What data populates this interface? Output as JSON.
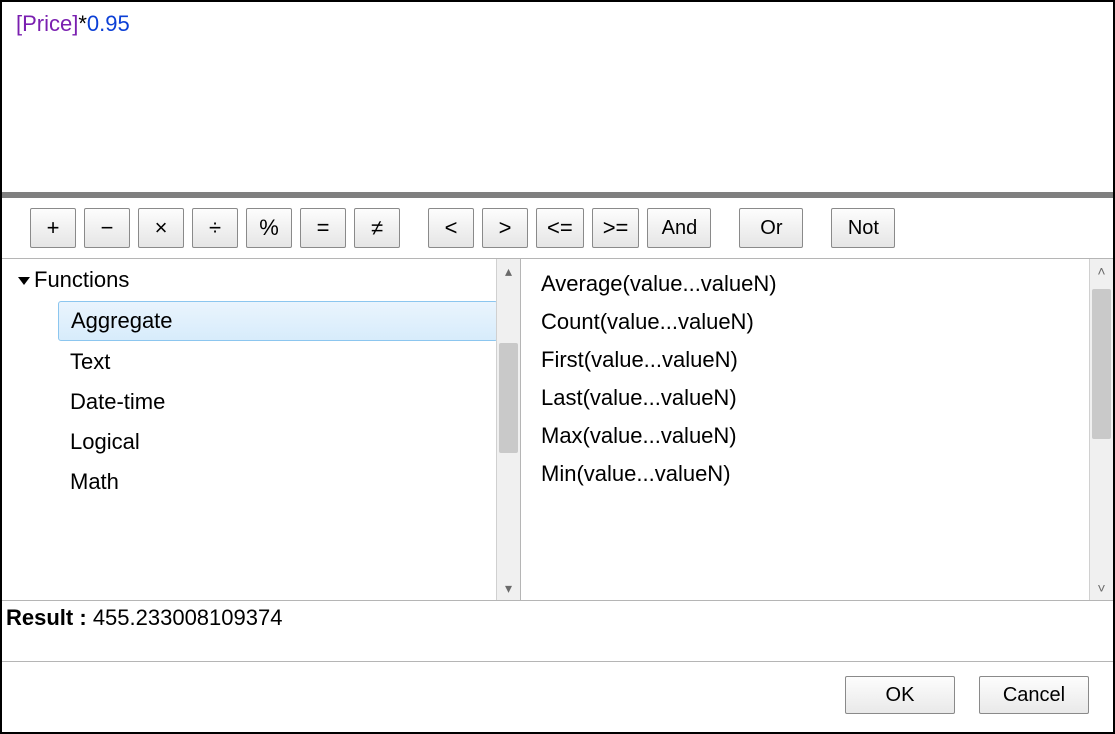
{
  "expression": {
    "field": "[Price]",
    "operator": "*",
    "number": "0.95"
  },
  "toolbar": {
    "ops": [
      "+",
      "−",
      "×",
      "÷",
      "%",
      "=",
      "≠",
      "<",
      ">",
      "<=",
      ">="
    ],
    "logic": [
      "And",
      "Or",
      "Not"
    ]
  },
  "tree": {
    "root_label": "Functions",
    "items": [
      "Aggregate",
      "Text",
      "Date-time",
      "Logical",
      "Math"
    ],
    "selected_index": 0
  },
  "functions": [
    "Average(value...valueN)",
    "Count(value...valueN)",
    "First(value...valueN)",
    "Last(value...valueN)",
    "Max(value...valueN)",
    "Min(value...valueN)"
  ],
  "result": {
    "label": "Result :",
    "value": "455.233008109374"
  },
  "footer": {
    "ok": "OK",
    "cancel": "Cancel"
  }
}
